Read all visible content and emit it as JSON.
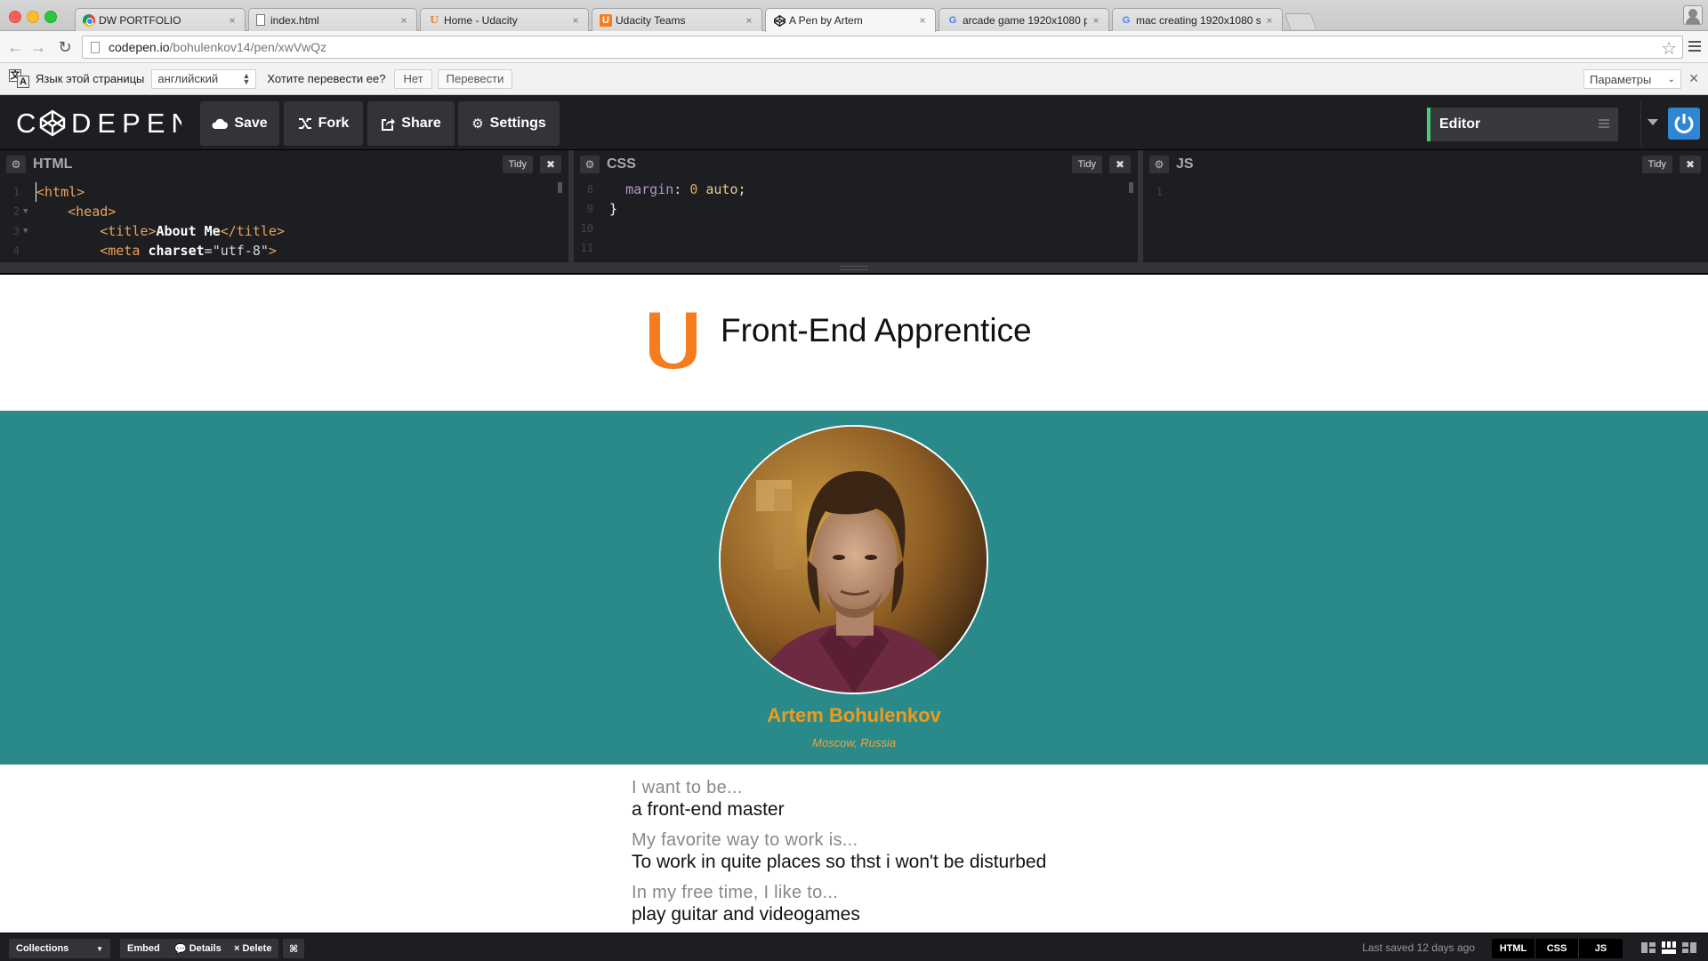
{
  "browser": {
    "tabs": [
      {
        "title": "DW PORTFOLIO",
        "favicon": "chrome-icon",
        "active": false
      },
      {
        "title": "index.html",
        "favicon": "file-icon",
        "active": false
      },
      {
        "title": "Home - Udacity",
        "favicon": "udacity-icon",
        "active": false
      },
      {
        "title": "Udacity Teams",
        "favicon": "udacity-box-icon",
        "active": false
      },
      {
        "title": "A Pen by Artem",
        "favicon": "codepen-icon",
        "active": true
      },
      {
        "title": "arcade game 1920x1080 p",
        "favicon": "google-icon",
        "active": false
      },
      {
        "title": "mac creating 1920x1080 s",
        "favicon": "google-icon",
        "active": false
      }
    ],
    "url_host": "codepen.io",
    "url_path": "/bohulenkov14/pen/xwVwQz",
    "translate": {
      "language_label": "Язык этой страницы",
      "language_value": "английский",
      "question": "Хотите перевести ее?",
      "no": "Нет",
      "translate": "Перевести",
      "options": "Параметры"
    }
  },
  "codepen": {
    "logo": "C   DEPEN",
    "buttons": {
      "save": "Save",
      "fork": "Fork",
      "share": "Share",
      "settings": "Settings"
    },
    "editor_menu": "Editor",
    "panes": [
      {
        "title": "HTML",
        "tidy": "Tidy"
      },
      {
        "title": "CSS",
        "tidy": "Tidy"
      },
      {
        "title": "JS",
        "tidy": "Tidy"
      }
    ],
    "html_code": {
      "l1": "<html>",
      "l2": "<head>",
      "l3_open": "<title>",
      "l3_text": "About Me",
      "l3_close": "</title>",
      "l4_tag": "<meta ",
      "l4_attr": "charset",
      "l4_eq": "=",
      "l4_val": "\"utf-8\"",
      "l4_end": ">"
    },
    "css_code": {
      "prop": "margin",
      "colon": ": ",
      "num": "0",
      "kw": "auto",
      "semi": ";",
      "brace": "}"
    },
    "line_numbers": {
      "html": [
        "1",
        "2",
        "3",
        "4"
      ],
      "css": [
        "8",
        "9",
        "10",
        "11"
      ],
      "js": [
        "1"
      ]
    },
    "footer": {
      "collections": "Collections",
      "embed": "Embed",
      "details": "Details",
      "delete": "Delete",
      "saved": "Last saved 12 days ago",
      "views": [
        "HTML",
        "CSS",
        "JS"
      ]
    }
  },
  "preview": {
    "site_title": "Front-End Apprentice",
    "name": "Artem Bohulenkov",
    "location": "Moscow, Russia",
    "items": [
      {
        "question": "I want to be...",
        "answer": "a front-end master"
      },
      {
        "question": "My favorite way to work is...",
        "answer": "To work in quite places so thst i won't be disturbed"
      },
      {
        "question": "In my free time, I like to...",
        "answer": "play guitar and videogames"
      }
    ],
    "colors": {
      "banner": "#2a8a8a",
      "name": "#f09a1a",
      "logo": "#f57c1f"
    }
  }
}
